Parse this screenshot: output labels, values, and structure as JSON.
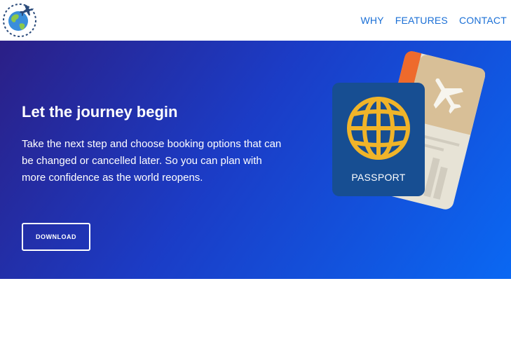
{
  "header": {
    "logo_icon": "globe-plane-icon",
    "nav": [
      {
        "label": "WHY"
      },
      {
        "label": "FEATURES"
      },
      {
        "label": "CONTACT"
      }
    ],
    "nav_color": "#1a6fd6"
  },
  "hero": {
    "title": "Let the journey begin",
    "description": "Take the next step and choose booking options that can be changed or cancelled later. So you can plan with more confidence as the world reopens.",
    "button_label": "DOWNLOAD",
    "gradient_colors": [
      "#2b1f86",
      "#1b3cc6",
      "#0a68f3"
    ],
    "illustration": {
      "icon": "passport-ticket-icon",
      "passport_label": "PASSPORT"
    }
  }
}
